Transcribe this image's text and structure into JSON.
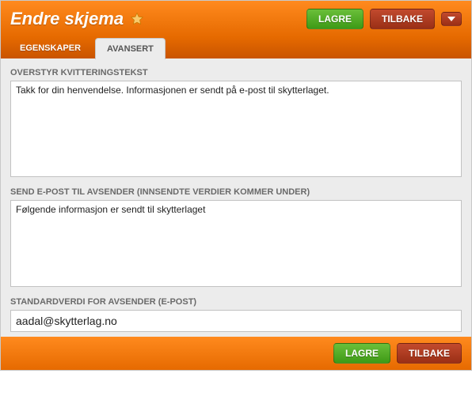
{
  "header": {
    "title": "Endre skjema",
    "save_label": "LAGRE",
    "back_label": "TILBAKE"
  },
  "tabs": {
    "t0": "EGENSKAPER",
    "t1": "AVANSERT"
  },
  "fields": {
    "receipt_label": "OVERSTYR KVITTERINGSTEKST",
    "receipt_value": "Takk for din henvendelse. Informasjonen er sendt på e-post til skytterlaget.",
    "email_label": "SEND E-POST TIL AVSENDER (INNSENDTE VERDIER KOMMER UNDER)",
    "email_value": "Følgende informasjon er sendt til skytterlaget",
    "default_sender_label": "STANDARDVERDI FOR AVSENDER (E-POST)",
    "default_sender_value": "aadal@skytterlag.no"
  },
  "footer": {
    "save_label": "LAGRE",
    "back_label": "TILBAKE"
  }
}
